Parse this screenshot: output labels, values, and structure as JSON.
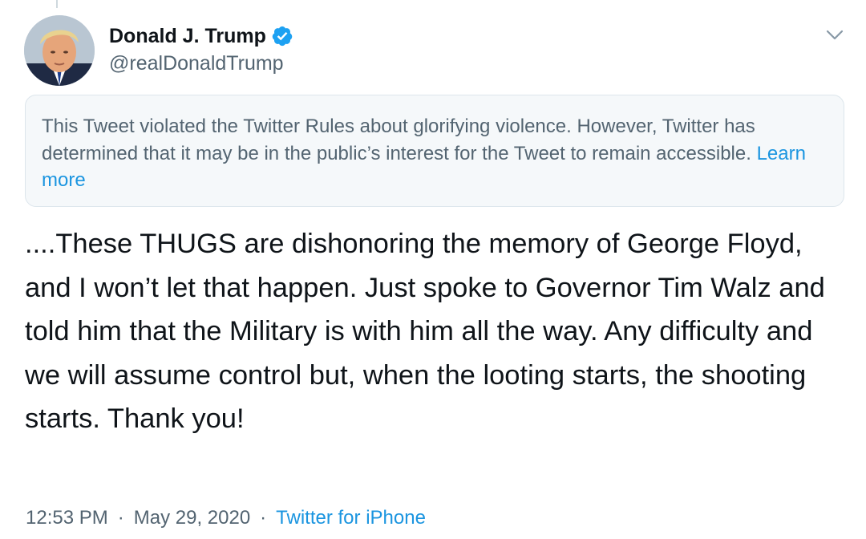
{
  "author": {
    "display_name": "Donald J. Trump",
    "handle": "@realDonaldTrump",
    "verified": true,
    "verified_icon": "verified-badge-icon"
  },
  "notice": {
    "text": "This Tweet violated the Twitter Rules about glorifying violence. However, Twitter has determined that it may be in the public’s interest for the Tweet to remain accessible.",
    "link_label": "Learn more"
  },
  "tweet": {
    "text": "....These THUGS are dishonoring the memory of George Floyd, and I won’t let that happen. Just spoke to Governor Tim Walz and told him that the Military is with him all the way. Any difficulty and we will assume control but, when the looting starts, the shooting starts. Thank you!"
  },
  "meta": {
    "time": "12:53 PM",
    "separator": "·",
    "date": "May 29, 2020",
    "source": "Twitter for iPhone"
  },
  "icons": {
    "more": "chevron-down-icon"
  },
  "colors": {
    "link": "#1b95e0",
    "secondary_text": "#536471",
    "primary_text": "#0f1419",
    "notice_bg": "#f5f8fa",
    "verified": "#1da1f2"
  }
}
